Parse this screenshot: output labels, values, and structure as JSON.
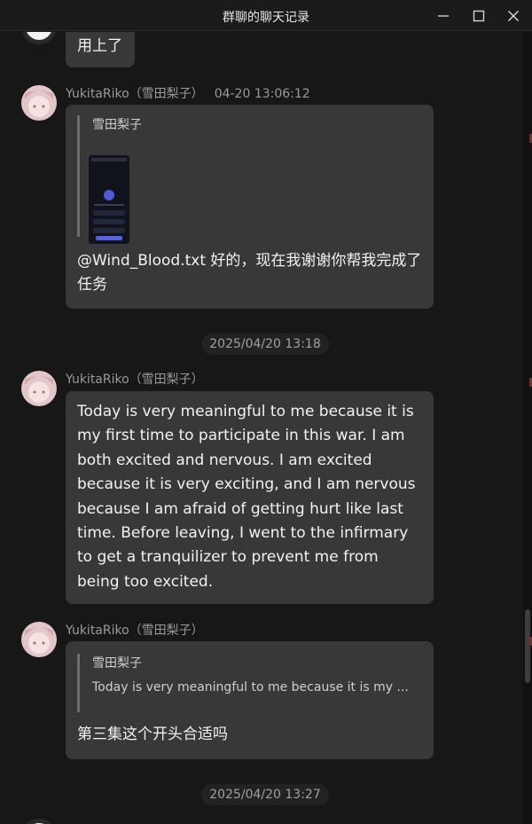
{
  "window": {
    "title": "群聊的聊天记录",
    "controls": {
      "minimize": "minimize-icon",
      "maximize": "maximize-icon",
      "close": "close-icon"
    }
  },
  "messages": [
    {
      "text": "用上了"
    },
    {
      "sender": "YukitaRiko（雪田梨子）",
      "time": "04-20 13:06:12",
      "quote_name": "雪田梨子",
      "text": "@Wind_Blood.txt 好的，现在我谢谢你帮我完成了任务"
    },
    {
      "timestamp": "2025/04/20 13:18"
    },
    {
      "sender": "YukitaRiko（雪田梨子）",
      "text": "Today is very meaningful to me because it is my first time to participate in this war. I am both excited and nervous. I am excited because it is very exciting, and I am nervous because I am afraid of getting hurt like last time. Before leaving, I went to the infirmary to get a tranquilizer to prevent me from being too excited."
    },
    {
      "sender": "YukitaRiko（雪田梨子）",
      "quote_name": "雪田梨子",
      "quote_text": "Today is very meaningful to me because it is my ...",
      "text": "第三集这个开头合适吗"
    },
    {
      "timestamp": "2025/04/20 13:27"
    }
  ],
  "colors": {
    "background": "#171717",
    "bubble": "#383838",
    "sender": "#9a9a9a"
  }
}
